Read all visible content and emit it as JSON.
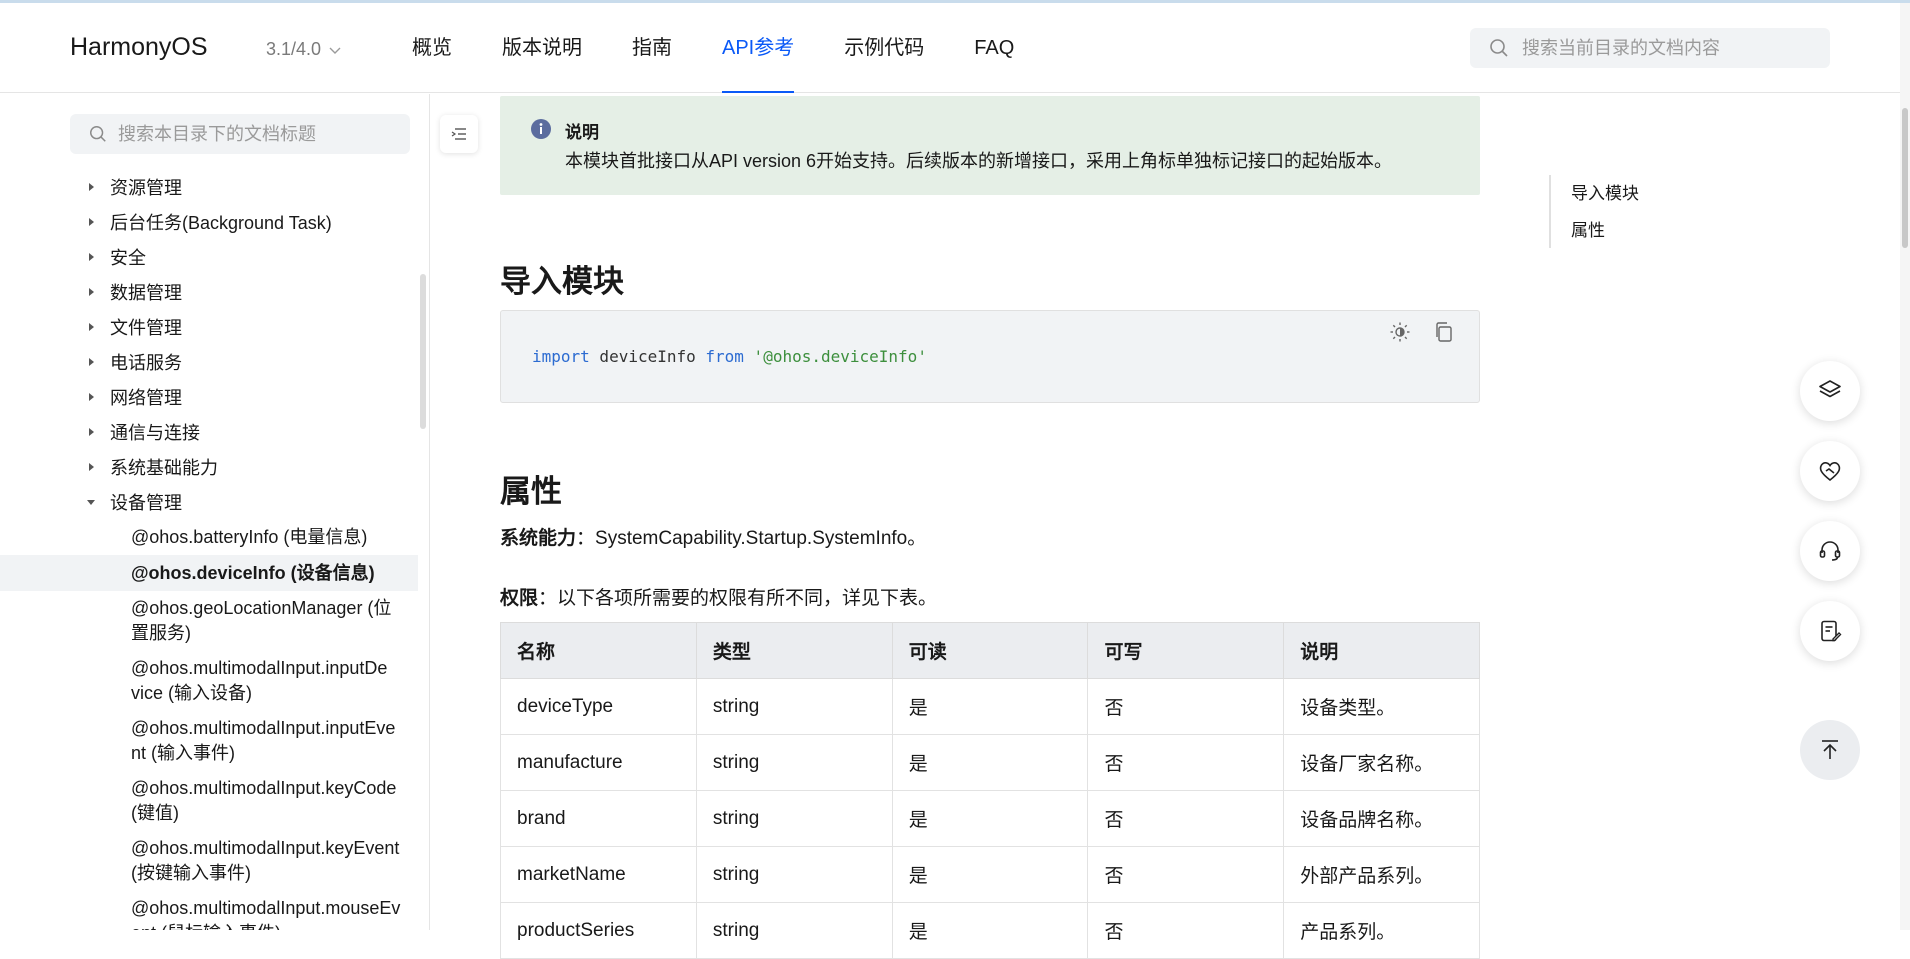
{
  "header": {
    "logo": "HarmonyOS",
    "version": "3.1/4.0",
    "nav": [
      {
        "label": "概览"
      },
      {
        "label": "版本说明"
      },
      {
        "label": "指南"
      },
      {
        "label": "API参考",
        "active": true
      },
      {
        "label": "示例代码"
      },
      {
        "label": "FAQ"
      }
    ],
    "search_placeholder": "搜索当前目录的文档内容"
  },
  "sidebar": {
    "search_placeholder": "搜索本目录下的文档标题",
    "items": [
      {
        "label": "资源管理",
        "expanded": false
      },
      {
        "label": "后台任务(Background Task)",
        "expanded": false
      },
      {
        "label": "安全",
        "expanded": false
      },
      {
        "label": "数据管理",
        "expanded": false
      },
      {
        "label": "文件管理",
        "expanded": false
      },
      {
        "label": "电话服务",
        "expanded": false
      },
      {
        "label": "网络管理",
        "expanded": false
      },
      {
        "label": "通信与连接",
        "expanded": false
      },
      {
        "label": "系统基础能力",
        "expanded": false
      },
      {
        "label": "设备管理",
        "expanded": true
      }
    ],
    "children": [
      {
        "label": "@ohos.batteryInfo (电量信息)"
      },
      {
        "label": "@ohos.deviceInfo (设备信息)",
        "selected": true
      },
      {
        "label_1": "@ohos.geoLocationManager (位",
        "label_2": "置服务)"
      },
      {
        "label_1": "@ohos.multimodalInput.inputDe",
        "label_2": "vice (输入设备)"
      },
      {
        "label_1": "@ohos.multimodalInput.inputEve",
        "label_2": "nt (输入事件)"
      },
      {
        "label_1": "@ohos.multimodalInput.keyCode",
        "label_2": "(键值)"
      },
      {
        "label_1": "@ohos.multimodalInput.keyEvent",
        "label_2": "(按键输入事件)"
      },
      {
        "label_1": "@ohos.multimodalInput.mouseEv",
        "label_2": "ent (鼠标输入事件)"
      }
    ]
  },
  "content": {
    "note": {
      "title": "说明",
      "text": "本模块首批接口从API version 6开始支持。后续版本的新增接口，采用上角标单独标记接口的起始版本。"
    },
    "import_heading": "导入模块",
    "code": {
      "kw1": "import",
      "name": " deviceInfo ",
      "kw2": "from",
      "str": " '@ohos.deviceInfo'"
    },
    "props_heading": "属性",
    "syscap_label": "系统能力",
    "syscap_text": "：SystemCapability.Startup.SystemInfo。",
    "perm_label": "权限",
    "perm_text": "：以下各项所需要的权限有所不同，详见下表。",
    "table": {
      "headers": [
        "名称",
        "类型",
        "可读",
        "可写",
        "说明"
      ],
      "rows": [
        [
          "deviceType",
          "string",
          "是",
          "否",
          "设备类型。"
        ],
        [
          "manufacture",
          "string",
          "是",
          "否",
          "设备厂家名称。"
        ],
        [
          "brand",
          "string",
          "是",
          "否",
          "设备品牌名称。"
        ],
        [
          "marketName",
          "string",
          "是",
          "否",
          "外部产品系列。"
        ],
        [
          "productSeries",
          "string",
          "是",
          "否",
          "产品系列。"
        ]
      ]
    }
  },
  "toc": [
    "导入模块",
    "属性"
  ],
  "fab_icons": [
    "layers-icon",
    "heart-check-icon",
    "headset-icon",
    "feedback-icon",
    "back-to-top-icon"
  ],
  "colors": {
    "accent": "#0a59f7",
    "note_bg": "#e5efe6"
  }
}
